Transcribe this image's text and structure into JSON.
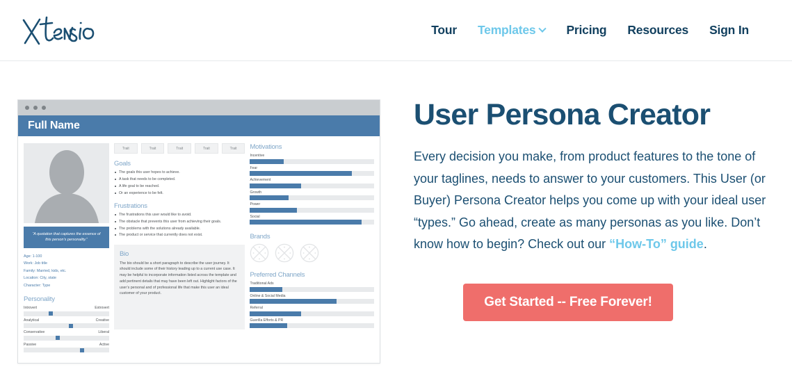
{
  "header": {
    "logo_text": "Xtensio",
    "nav": [
      {
        "label": "Tour",
        "active": false,
        "has_chevron": false
      },
      {
        "label": "Templates",
        "active": true,
        "has_chevron": true
      },
      {
        "label": "Pricing",
        "active": false,
        "has_chevron": false
      },
      {
        "label": "Resources",
        "active": false,
        "has_chevron": false
      },
      {
        "label": "Sign In",
        "active": false,
        "has_chevron": false
      }
    ]
  },
  "hero": {
    "title": "User Persona Creator",
    "paragraph_part1": "Every decision you make, from product features to the tone of your taglines, needs to answer to your customers. This User (or Buyer) Persona Creator helps you come up with your ideal user “types.” Go ahead, create as many personas as you like. Don’t know how to begin? Check out our ",
    "link_text": "“How-To” guide",
    "paragraph_part2": ".",
    "cta_label": "Get Started -- Free Forever!",
    "cta_color": "#ef6e6b",
    "title_color": "#1b4f72",
    "link_color": "#6ec8ea"
  },
  "preview": {
    "card_title": "Full Name",
    "header_color": "#4a7baa",
    "left": {
      "avatar_alt": "person-silhouette",
      "quote": "“A quotation that captures the essence of this person’s personality.”",
      "details": [
        "Age: 1-100",
        "Work: Job title",
        "Family: Married, kids, etc.",
        "Location: City, state",
        "Character: Type"
      ],
      "personality_title": "Personality",
      "sliders": [
        {
          "left": "Introvert",
          "right": "Extrovert",
          "value": 32
        },
        {
          "left": "Analytical",
          "right": "Creative",
          "value": 55
        },
        {
          "left": "Conservative",
          "right": "Liberal",
          "value": 40
        },
        {
          "left": "Passive",
          "right": "Active",
          "value": 68
        }
      ]
    },
    "mid": {
      "traits": [
        "Trait",
        "Trait",
        "Trait",
        "Trait",
        "Trait"
      ],
      "goals_title": "Goals",
      "goals": [
        "The goals this user hopes to achieve.",
        "A task that needs to be completed.",
        "A life goal to be reached.",
        "Or an experience to be felt."
      ],
      "frustrations_title": "Frustrations",
      "frustrations": [
        "The frustrations this user would like to avoid.",
        "The obstacle that prevents this user from achieving their goals.",
        "The problems with the solutions already available.",
        "The product or service that currently does not exist."
      ],
      "bio_title": "Bio",
      "bio_text": "The bio should be a short paragraph to describe the user journey. It should include some of their history leading up to a current use case. It may be helpful to incorporate information listed across the template and add pertinent details that may have been left out. Highlight factors of the user’s personal and of professional life that make this user an ideal customer of your product."
    },
    "right": {
      "motivations_title": "Motivations",
      "motivations": [
        {
          "label": "Incentive",
          "value": 27
        },
        {
          "label": "Fear",
          "value": 82
        },
        {
          "label": "Achievement",
          "value": 41
        },
        {
          "label": "Growth",
          "value": 31
        },
        {
          "label": "Power",
          "value": 38
        },
        {
          "label": "Social",
          "value": 90
        }
      ],
      "brands_title": "Brands",
      "brands_count": 3,
      "channels_title": "Preferred Channels",
      "channels": [
        {
          "label": "Traditional Ads",
          "value": 26
        },
        {
          "label": "Online & Social Media",
          "value": 70
        },
        {
          "label": "Referral",
          "value": 41
        },
        {
          "label": "Guerilla Efforts & PR",
          "value": 30
        }
      ]
    }
  }
}
